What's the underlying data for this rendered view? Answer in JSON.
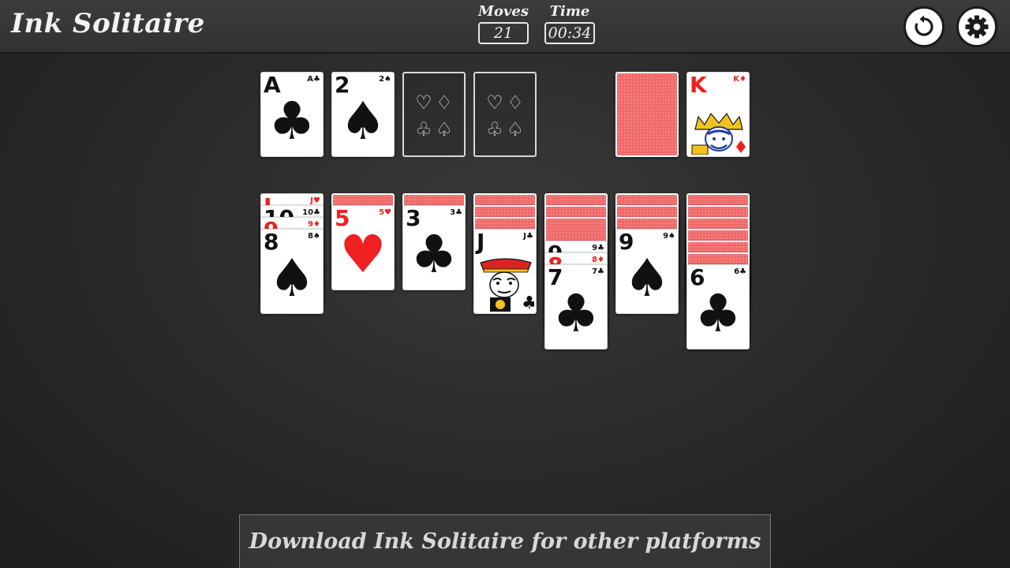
{
  "app": {
    "title": "Ink Solitaire"
  },
  "stats": {
    "moves_label": "Moves",
    "moves_value": "21",
    "time_label": "Time",
    "time_value": "00:34"
  },
  "icons": {
    "restart": "restart-icon",
    "settings": "gear-icon"
  },
  "colors": {
    "card_back": "#f06a6a",
    "red_suit": "#ee2020",
    "table": "#2b2b2b"
  },
  "slot_suits": [
    "♡",
    "♢",
    "♧",
    "♤"
  ],
  "foundations": [
    {
      "rank": "A",
      "suit": "♣",
      "color": "black"
    },
    {
      "rank": "2",
      "suit": "♠",
      "color": "black"
    }
  ],
  "waste": {
    "rank": "K",
    "suit": "♦",
    "color": "red"
  },
  "tableau": [
    {
      "hidden_up": [
        {
          "rank": "J",
          "suit": "♥",
          "color": "red"
        },
        {
          "rank": "10",
          "suit": "♣",
          "color": "black"
        },
        {
          "rank": "9",
          "suit": "♦",
          "color": "red"
        }
      ],
      "top": {
        "rank": "8",
        "suit": "♠",
        "color": "black"
      }
    },
    {
      "top": {
        "rank": "5",
        "suit": "♥",
        "color": "red"
      }
    },
    {
      "top": {
        "rank": "3",
        "suit": "♣",
        "color": "black"
      }
    },
    {
      "top": {
        "rank": "J",
        "suit": "♣",
        "color": "black"
      }
    },
    {
      "hidden_up": [
        {
          "rank": "9",
          "suit": "♣",
          "color": "black"
        },
        {
          "rank": "8",
          "suit": "♦",
          "color": "red"
        }
      ],
      "top": {
        "rank": "7",
        "suit": "♣",
        "color": "black"
      }
    },
    {
      "top": {
        "rank": "9",
        "suit": "♠",
        "color": "black"
      }
    },
    {
      "top": {
        "rank": "6",
        "suit": "♣",
        "color": "black"
      }
    }
  ],
  "banner": {
    "text": "Download Ink Solitaire for other platforms"
  }
}
